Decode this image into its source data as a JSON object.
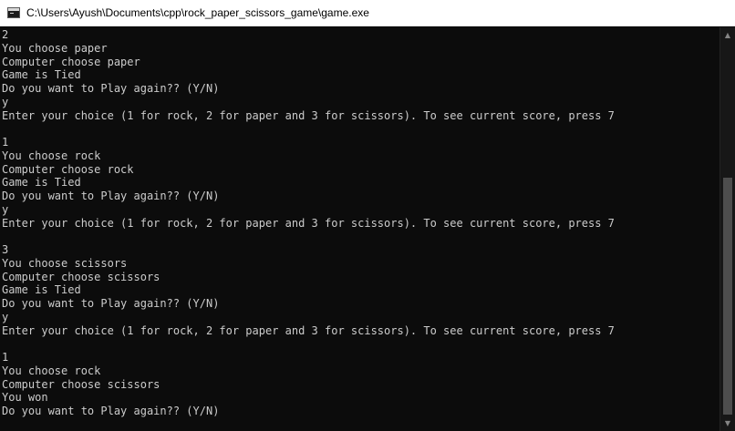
{
  "window": {
    "title": "C:\\Users\\Ayush\\Documents\\cpp\\rock_paper_scissors_game\\game.exe"
  },
  "console": {
    "lines": [
      "2",
      "You choose paper",
      "Computer choose paper",
      "Game is Tied",
      "Do you want to Play again?? (Y/N)",
      "y",
      "Enter your choice (1 for rock, 2 for paper and 3 for scissors). To see current score, press 7",
      "",
      "1",
      "You choose rock",
      "Computer choose rock",
      "Game is Tied",
      "Do you want to Play again?? (Y/N)",
      "y",
      "Enter your choice (1 for rock, 2 for paper and 3 for scissors). To see current score, press 7",
      "",
      "3",
      "You choose scissors",
      "Computer choose scissors",
      "Game is Tied",
      "Do you want to Play again?? (Y/N)",
      "y",
      "Enter your choice (1 for rock, 2 for paper and 3 for scissors). To see current score, press 7",
      "",
      "1",
      "You choose rock",
      "Computer choose scissors",
      "You won",
      "Do you want to Play again?? (Y/N)"
    ],
    "text_color": "#cccccc",
    "background_color": "#0c0c0c"
  },
  "icons": {
    "app": "console-window-icon",
    "scroll_up": "scroll-up-arrow-icon",
    "scroll_down": "scroll-down-arrow-icon"
  }
}
